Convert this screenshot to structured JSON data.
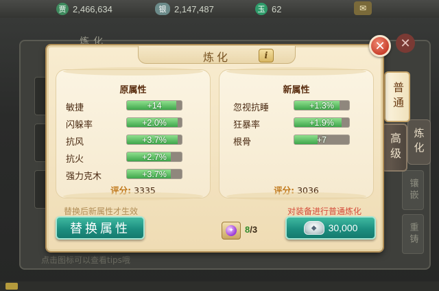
{
  "resources": {
    "coin": {
      "icon": "coin-icon",
      "glyph": "贾",
      "value": "2,466,634",
      "color": "#3f8b5e"
    },
    "silver": {
      "icon": "silver-ingot-icon",
      "glyph": "银",
      "value": "2,147,487",
      "color": "#6c8b8a"
    },
    "jade": {
      "icon": "jade-icon",
      "glyph": "玉",
      "value": "62",
      "color": "#2f9b6a"
    }
  },
  "background": {
    "title": "炼化",
    "hint": "点击图标可以查看tips哦",
    "right_tabs": [
      "镶嵌",
      "重铸"
    ],
    "right_tab_refine": "炼化"
  },
  "dialog": {
    "title": "炼化",
    "info_label": "i",
    "close_label": "✕",
    "left_panel": {
      "title": "原属性",
      "attributes": [
        {
          "name": "敏捷",
          "value": "+14",
          "fill": 0.9
        },
        {
          "name": "闪躲率",
          "value": "+2.0%",
          "fill": 0.92
        },
        {
          "name": "抗风",
          "value": "+3.7%",
          "fill": 0.92
        },
        {
          "name": "抗火",
          "value": "+2.7%",
          "fill": 0.8
        },
        {
          "name": "强力克木",
          "value": "+3.7%",
          "fill": 0.8
        }
      ],
      "score_label": "评分:",
      "score_value": "3335"
    },
    "right_panel": {
      "title": "新属性",
      "attributes": [
        {
          "name": "忽视抗睡",
          "value": "+1.3%",
          "fill": 0.82
        },
        {
          "name": "狂暴率",
          "value": "+1.9%",
          "fill": 0.86
        },
        {
          "name": "根骨",
          "value": "+7",
          "fill": 0.42
        }
      ],
      "score_label": "评分:",
      "score_value": "3036"
    },
    "hint_left": "替换后新属性才生效",
    "hint_right": "对装备进行普通炼化",
    "replace_button": "替换属性",
    "material": {
      "icon": "purple-gem-icon",
      "have": "8",
      "need": "/3"
    },
    "refine_button": {
      "icon": "silver-ingot-icon",
      "cost": "30,000"
    }
  },
  "tabs": {
    "normal": "普通",
    "advanced": "高级"
  }
}
